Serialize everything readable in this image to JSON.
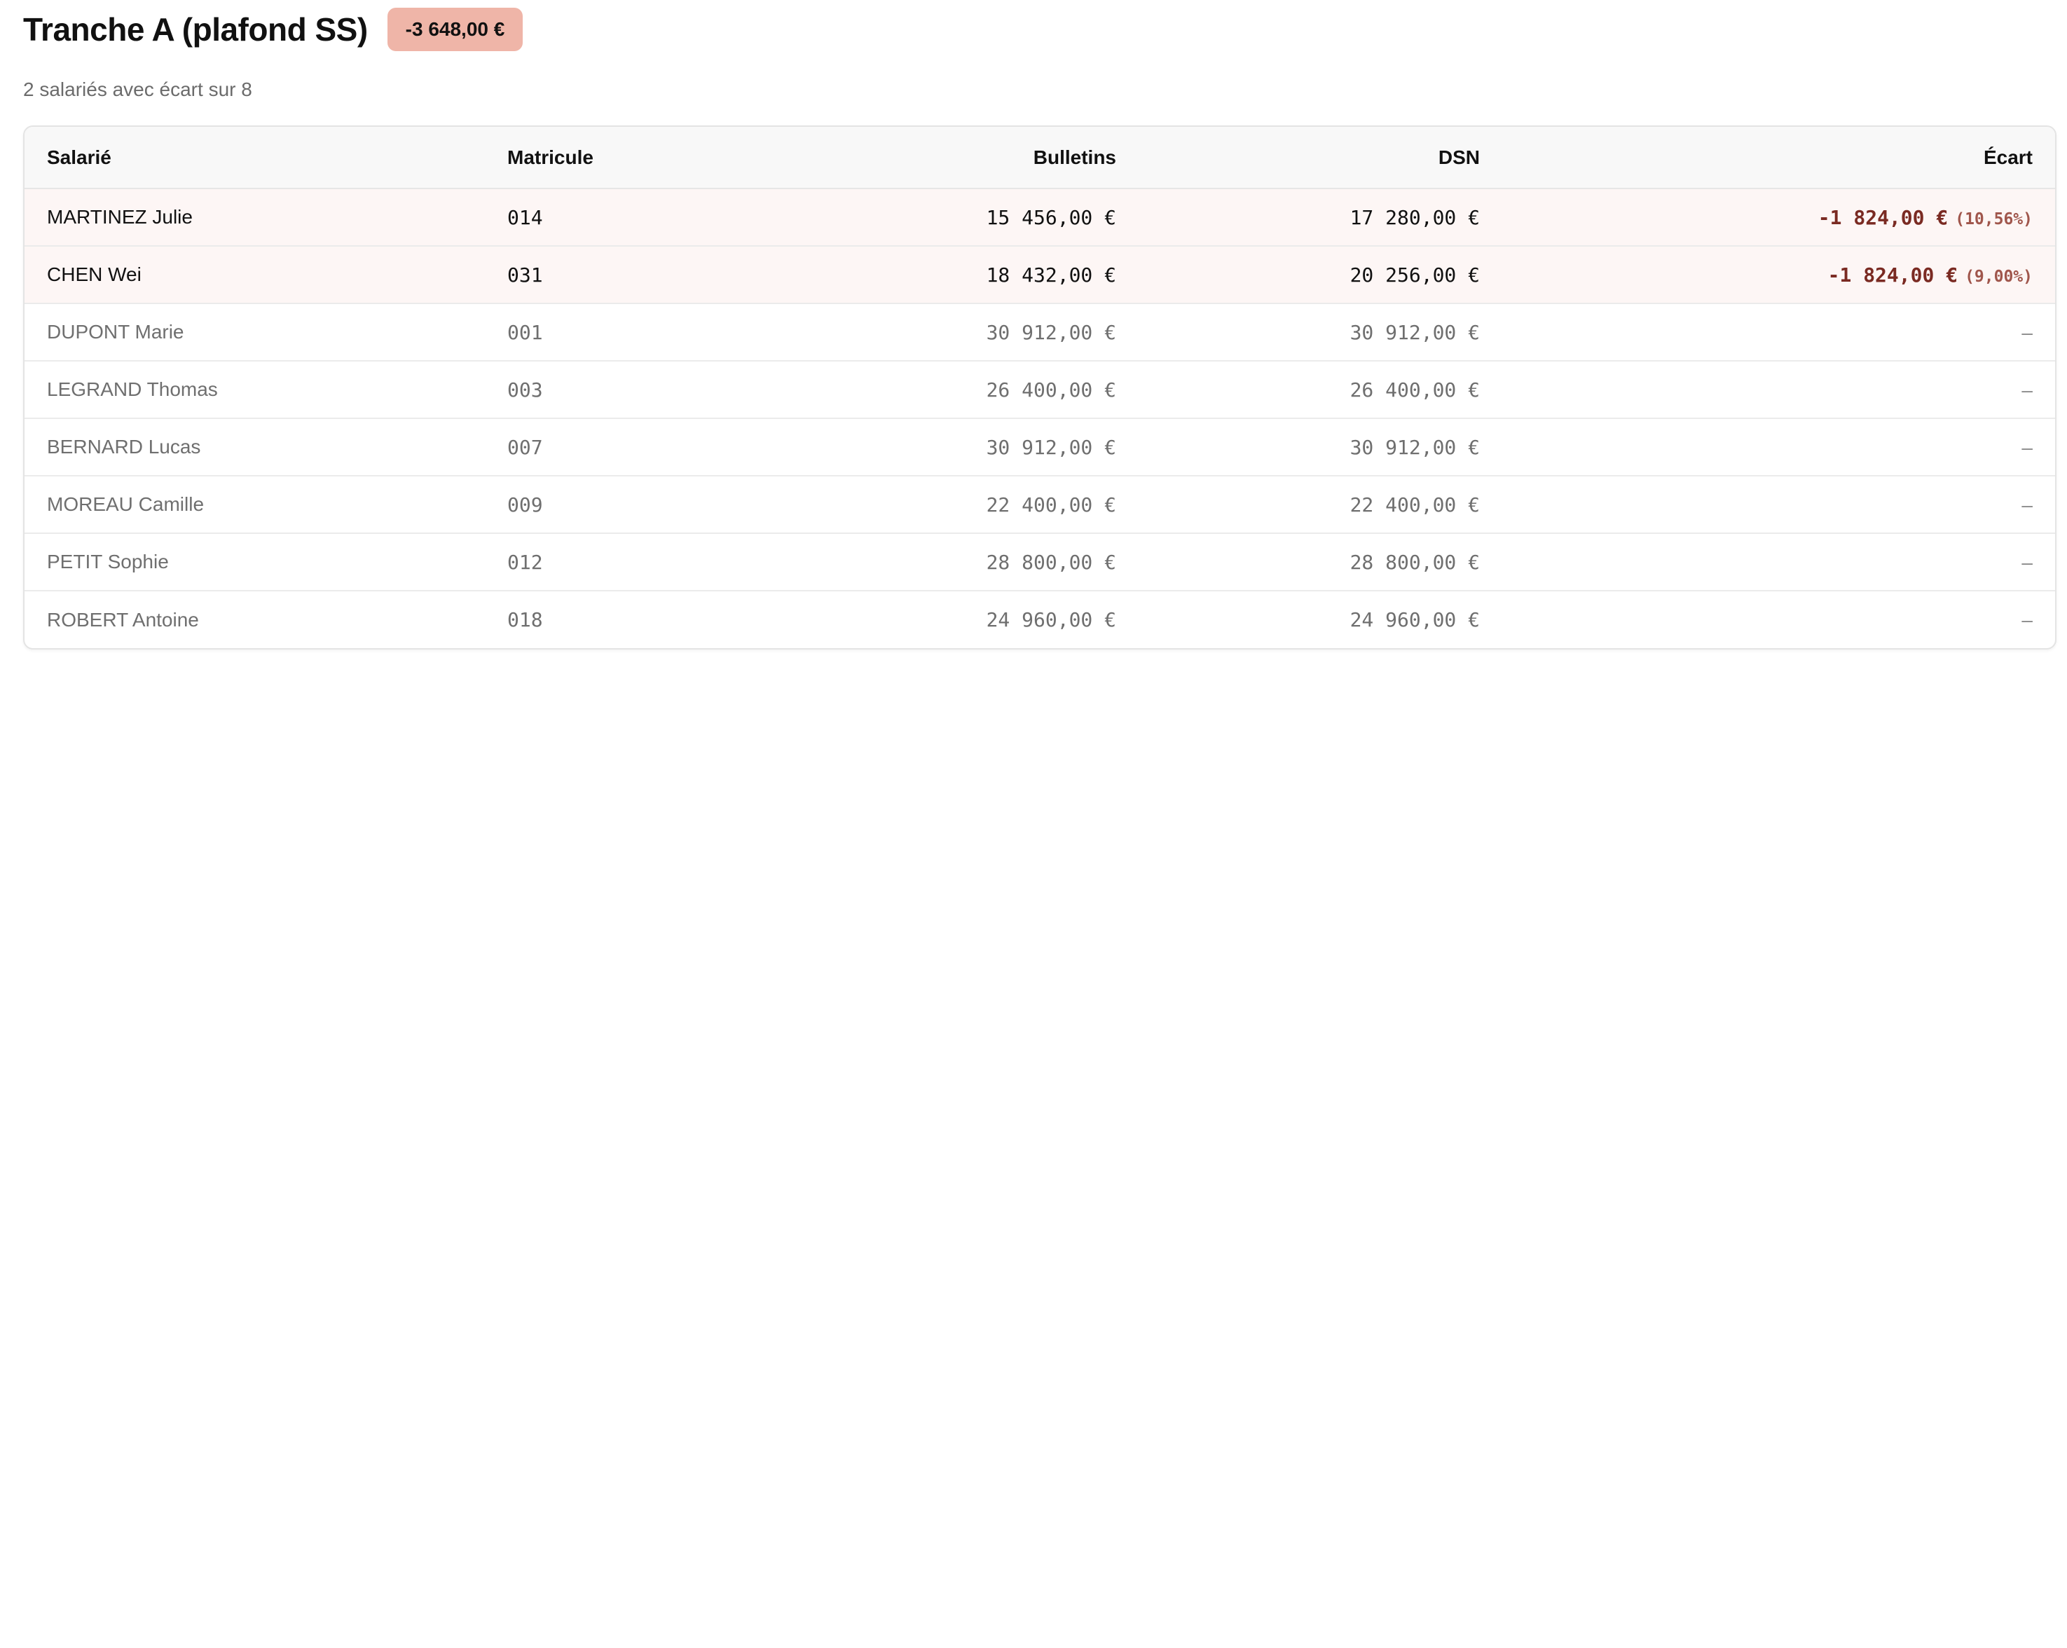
{
  "header": {
    "title": "Tranche A (plafond SS)",
    "total_badge": "-3 648,00 €",
    "subtitle": "2 salariés avec écart sur 8"
  },
  "table": {
    "columns": {
      "name": "Salarié",
      "matricule": "Matricule",
      "bulletins": "Bulletins",
      "dsn": "DSN",
      "ecart": "Écart"
    },
    "rows": [
      {
        "name": "MARTINEZ Julie",
        "matricule": "014",
        "bulletins": "15 456,00 €",
        "dsn": "17 280,00 €",
        "ecart_amount": "-1 824,00 €",
        "ecart_pct": "(10,56%)",
        "flagged": true
      },
      {
        "name": "CHEN Wei",
        "matricule": "031",
        "bulletins": "18 432,00 €",
        "dsn": "20 256,00 €",
        "ecart_amount": "-1 824,00 €",
        "ecart_pct": "(9,00%)",
        "flagged": true
      },
      {
        "name": "DUPONT Marie",
        "matricule": "001",
        "bulletins": "30 912,00 €",
        "dsn": "30 912,00 €",
        "ecart_amount": "–",
        "flagged": false
      },
      {
        "name": "LEGRAND Thomas",
        "matricule": "003",
        "bulletins": "26 400,00 €",
        "dsn": "26 400,00 €",
        "ecart_amount": "–",
        "flagged": false
      },
      {
        "name": "BERNARD Lucas",
        "matricule": "007",
        "bulletins": "30 912,00 €",
        "dsn": "30 912,00 €",
        "ecart_amount": "–",
        "flagged": false
      },
      {
        "name": "MOREAU Camille",
        "matricule": "009",
        "bulletins": "22 400,00 €",
        "dsn": "22 400,00 €",
        "ecart_amount": "–",
        "flagged": false
      },
      {
        "name": "PETIT Sophie",
        "matricule": "012",
        "bulletins": "28 800,00 €",
        "dsn": "28 800,00 €",
        "ecart_amount": "–",
        "flagged": false
      },
      {
        "name": "ROBERT Antoine",
        "matricule": "018",
        "bulletins": "24 960,00 €",
        "dsn": "24 960,00 €",
        "ecart_amount": "–",
        "flagged": false
      }
    ]
  },
  "colors": {
    "badge_background": "#efb5a8",
    "flagged_row_background": "#fdf6f5",
    "ecart_text": "#7a2a22"
  }
}
